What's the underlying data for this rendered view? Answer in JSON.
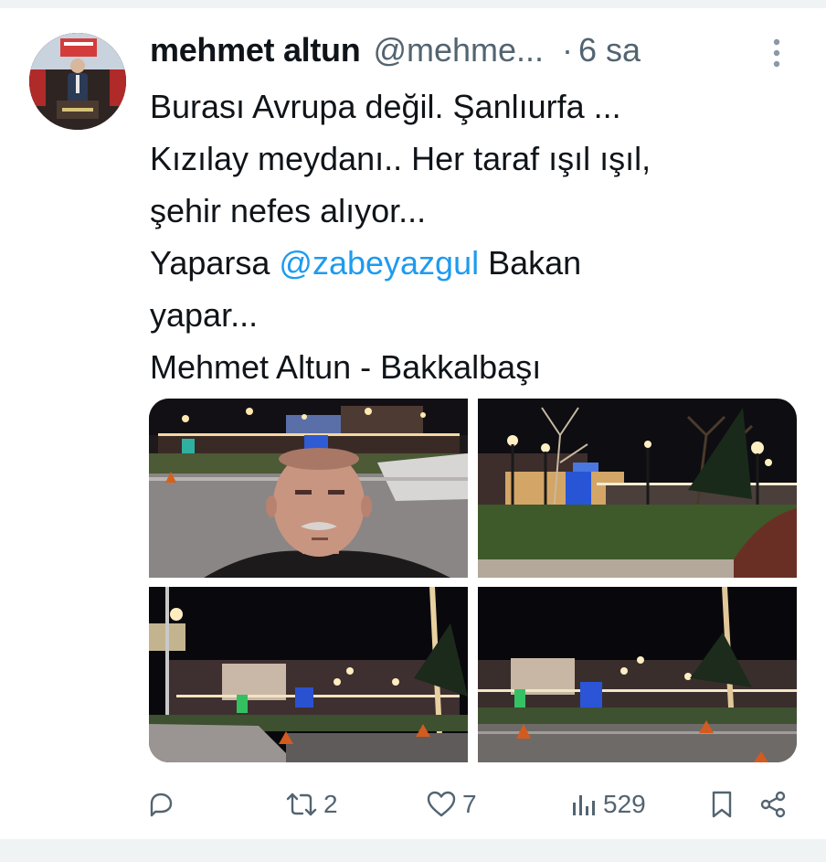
{
  "tweet": {
    "author_name": "mehmet altun",
    "author_handle": "@mehme...",
    "separator": "·",
    "time": "6 sa",
    "text_lines": [
      [
        {
          "text": "Burası Avrupa değil.  Şanlıurfa ..."
        }
      ],
      [
        {
          "text": "Kızılay meydanı.. Her taraf ışıl ışıl,"
        }
      ],
      [
        {
          "text": "şehir nefes alıyor..."
        }
      ],
      [
        {
          "text": "Yaparsa "
        },
        {
          "text": "@zabeyazgul",
          "mention": true
        },
        {
          "text": " Bakan"
        }
      ],
      [
        {
          "text": "yapar..."
        }
      ],
      [
        {
          "text": "Mehmet Altun - Bakkalbaşı"
        }
      ]
    ]
  },
  "media": [
    {
      "icon": "photo-selfie-in-square"
    },
    {
      "icon": "photo-park-night"
    },
    {
      "icon": "photo-square-wide-night"
    },
    {
      "icon": "photo-square-palms-night"
    }
  ],
  "actions": {
    "reply": {
      "icon": "reply-icon",
      "count": ""
    },
    "retweet": {
      "icon": "retweet-icon",
      "count": "2"
    },
    "like": {
      "icon": "heart-icon",
      "count": "7"
    },
    "views": {
      "icon": "views-icon",
      "count": "529"
    },
    "bookmark": {
      "icon": "bookmark-icon",
      "count": ""
    },
    "share": {
      "icon": "share-icon",
      "count": ""
    }
  },
  "colors": {
    "mention": "#1d9bf0",
    "muted": "#536471",
    "text": "#0f1419",
    "divider": "#eff3f4"
  }
}
